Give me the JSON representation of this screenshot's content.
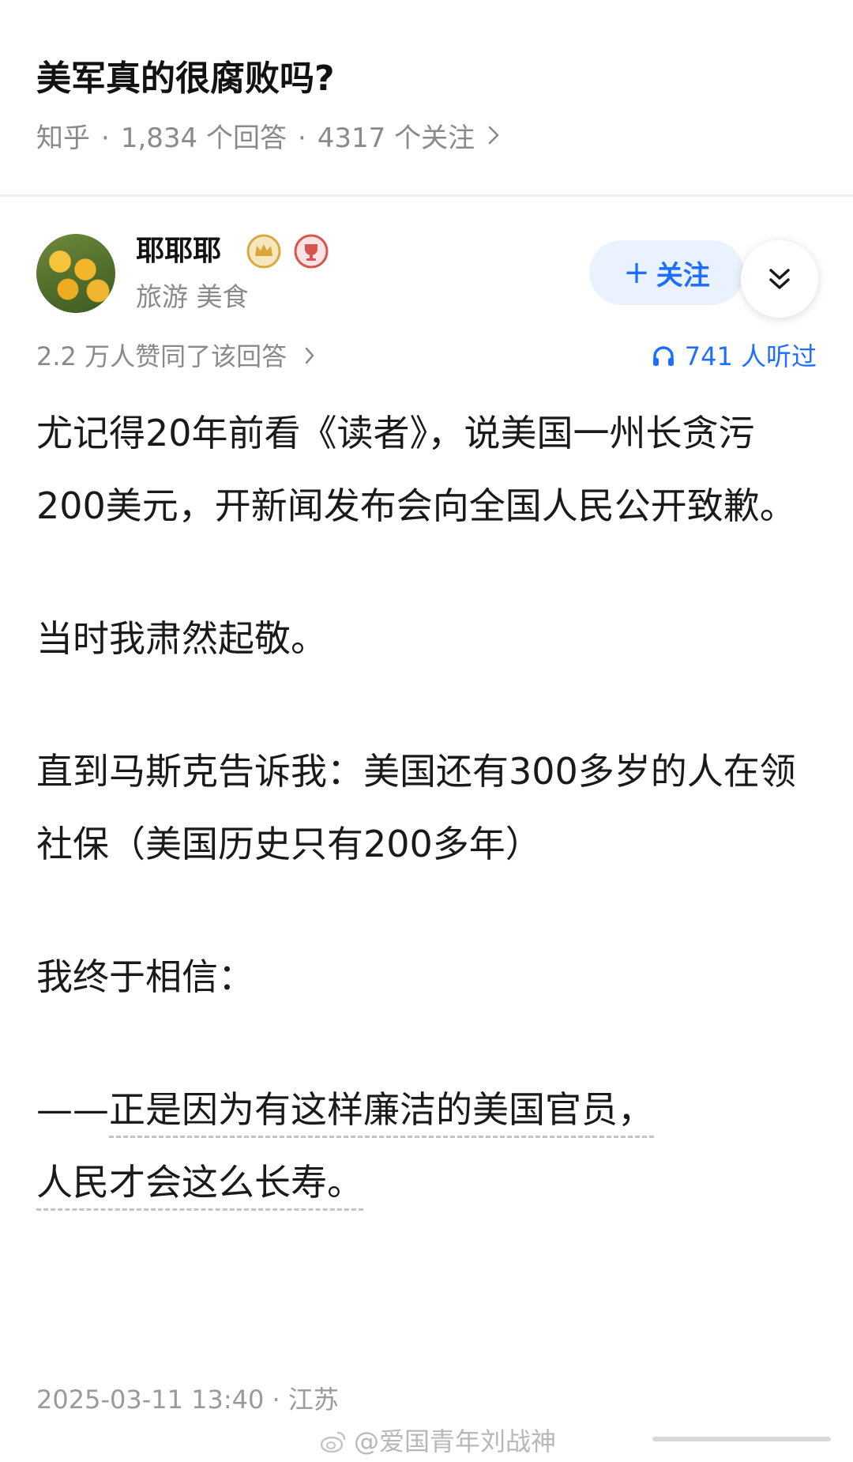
{
  "question": {
    "title": "美军真的很腐败吗?",
    "source": "知乎",
    "answers": "1,834 个回答",
    "followers": "4317 个关注",
    "separator": "·"
  },
  "author": {
    "name": "耶耶耶",
    "tags": "旅游 美食",
    "avatar_icon": "avatar-oranges",
    "follow_label": "关注",
    "follow_plus": "+"
  },
  "stats": {
    "upvotes": "2.2 万人赞同了该回答",
    "listened": "741 人听过"
  },
  "answer": {
    "paragraphs": [
      "尤记得20年前看《读者》，说美国一州长贪污200美元，开新闻发布会向全国人民公开致歉。",
      "当时我肃然起敬。",
      "直到马斯克告诉我：美国还有300多岁的人在领社保（美国历史只有200多年）",
      "我终于相信："
    ],
    "last_prefix": "——",
    "last_line1": "正是因为有这样廉洁的美国官员，",
    "last_line2": "人民才会这么长寿。"
  },
  "footer": {
    "timestamp": "2025-03-11 13:40 · 江苏",
    "watermark": "@爱国青年刘战神"
  },
  "colors": {
    "accent": "#1e6fff",
    "follow_bg": "#eaf2ff",
    "muted": "#8a8a8a"
  }
}
